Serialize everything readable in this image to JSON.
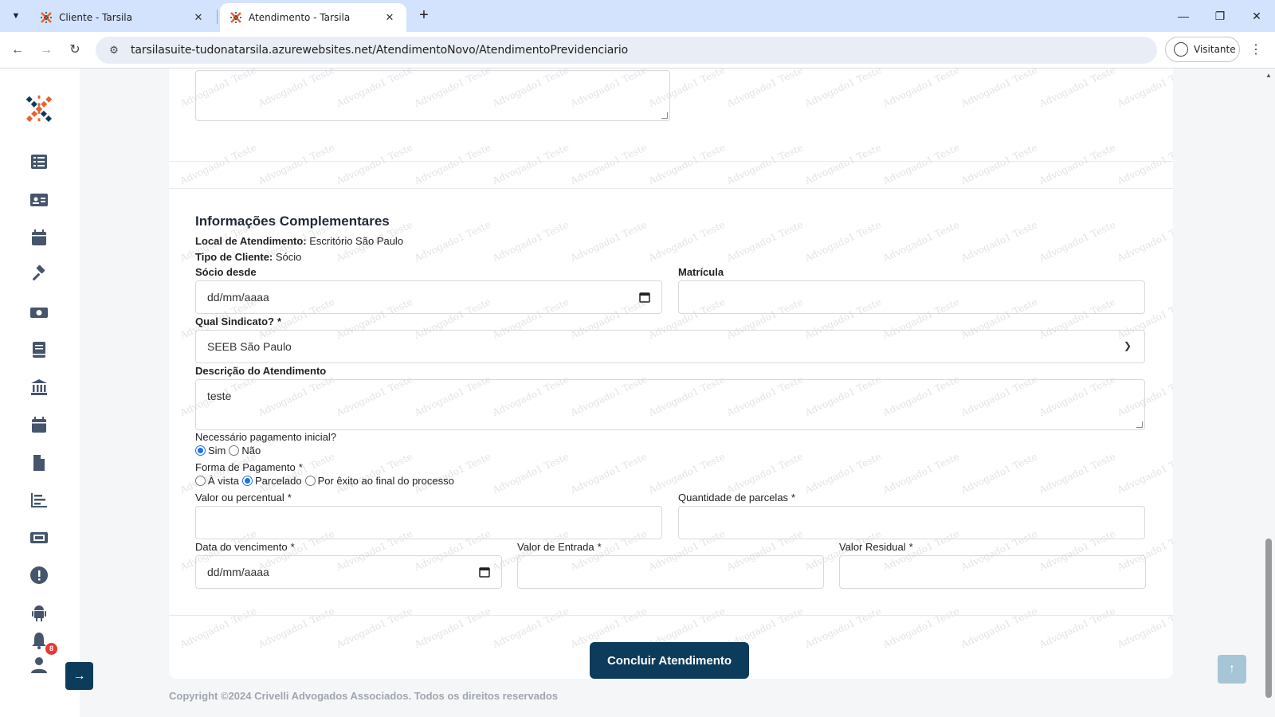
{
  "browser": {
    "tabs": [
      {
        "title": "Cliente - Tarsila",
        "active": false
      },
      {
        "title": "Atendimento - Tarsila",
        "active": true
      }
    ],
    "url": "tarsilasuite-tudonatarsila.azurewebsites.net/AtendimentoNovo/AtendimentoPrevidenciario",
    "profile_label": "Visitante"
  },
  "sidebar": {
    "icons": [
      "list-icon",
      "id-card-icon",
      "calendar-icon",
      "gavel-icon",
      "money-icon",
      "book-icon",
      "bank-icon",
      "calendar-alt-icon",
      "file-icon",
      "chart-icon",
      "ticket-icon",
      "alert-icon",
      "android-icon",
      "bell-icon",
      "user-icon"
    ],
    "notification_count": "8"
  },
  "section": {
    "title": "Informações Complementares",
    "local_label": "Local de Atendimento:",
    "local_value": "Escritório São Paulo",
    "tipo_label": "Tipo de Cliente:",
    "tipo_value": "Sócio"
  },
  "form": {
    "socio_desde_label": "Sócio desde",
    "socio_desde_placeholder": "dd/mm/aaaa",
    "matricula_label": "Matrícula",
    "matricula_value": "",
    "sindicato_label": "Qual Sindicato?",
    "sindicato_value": "SEEB São Paulo",
    "descricao_label": "Descrição do Atendimento",
    "descricao_value": "teste",
    "pagamento_inicial_label": "Necessário pagamento inicial?",
    "pagamento_inicial_options": [
      "Sim",
      "Não"
    ],
    "pagamento_inicial_selected": "Sim",
    "forma_pagamento_label": "Forma de Pagamento",
    "forma_pagamento_options": [
      "À vista",
      "Parcelado",
      "Por êxito ao final do processo"
    ],
    "forma_pagamento_selected": "Parcelado",
    "valor_label": "Valor ou percentual",
    "valor_value": "",
    "parcelas_label": "Quantidade de parcelas",
    "parcelas_value": "",
    "vencimento_label": "Data do vencimento",
    "vencimento_placeholder": "dd/mm/aaaa",
    "entrada_label": "Valor de Entrada",
    "entrada_value": "",
    "residual_label": "Valor Residual",
    "residual_value": "",
    "required_mark": "*",
    "submit_label": "Concluir Atendimento"
  },
  "watermark_text": "Advogado1 Teste",
  "footer": "Copyright ©2024 Crivelli Advogados Associados. Todos os direitos reservados",
  "colors": {
    "primary": "#0d3b5c",
    "logo_orange": "#e8632b",
    "logo_navy": "#0d3b5c",
    "badge_red": "#e53935"
  }
}
